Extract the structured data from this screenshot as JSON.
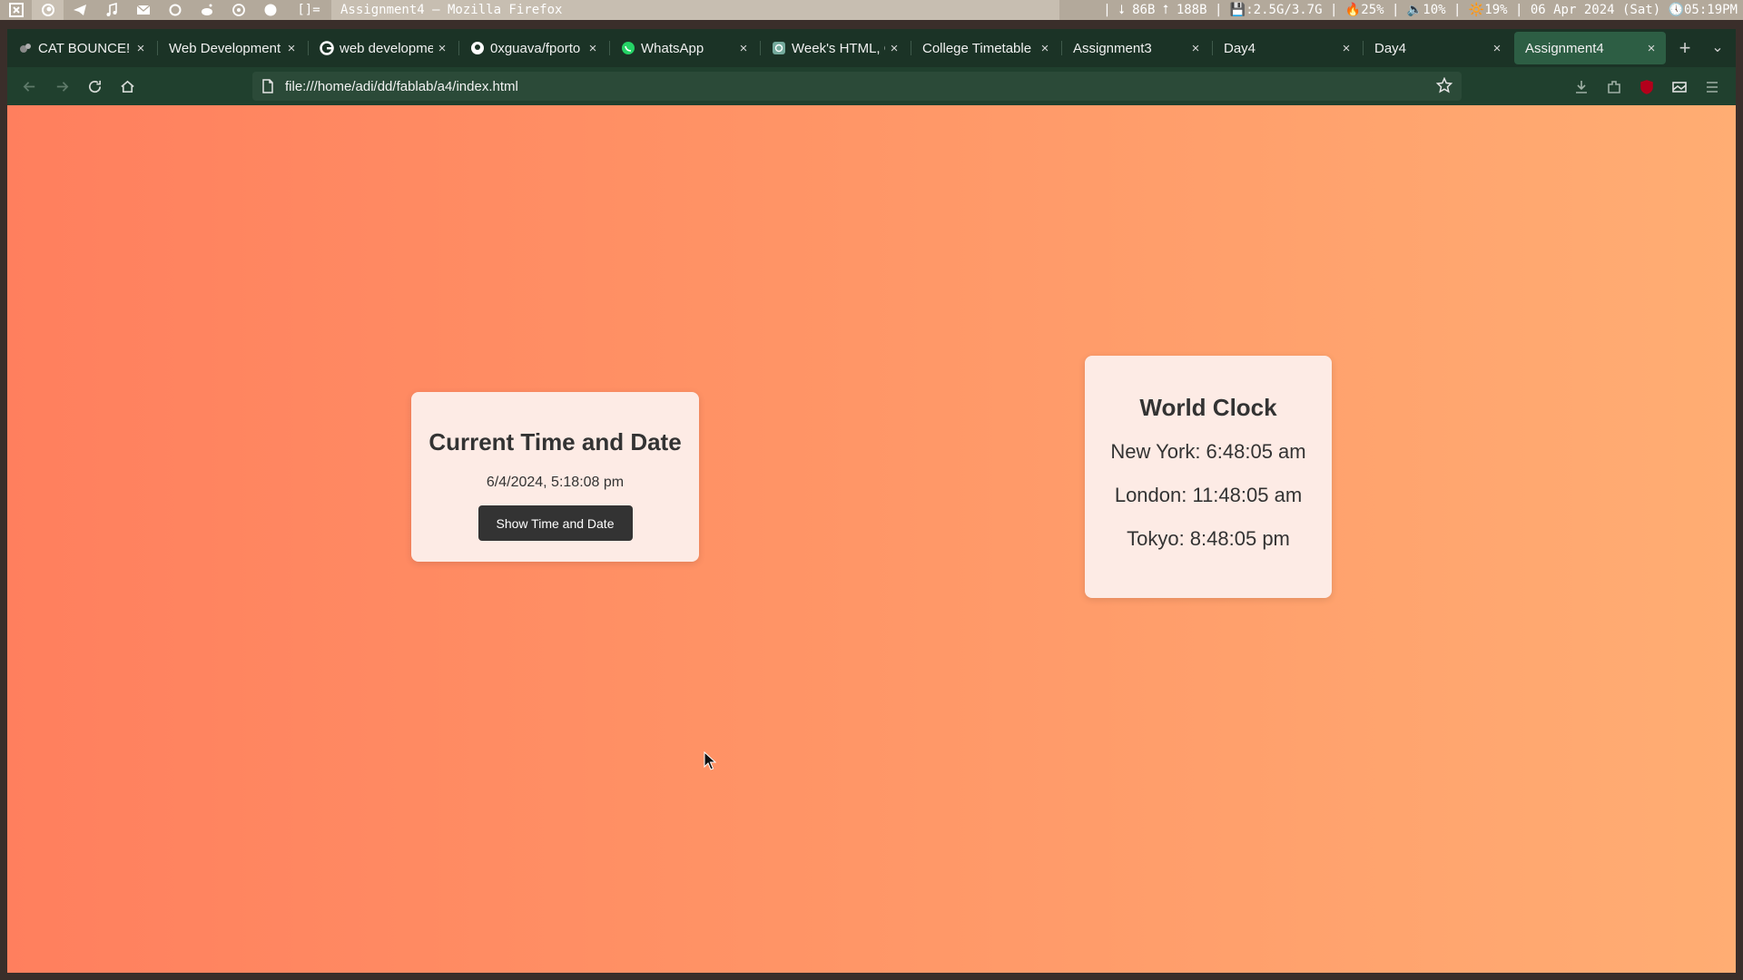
{
  "system_bar": {
    "layout_indicator": "[]=",
    "window_title": "Assignment4 — Mozilla Firefox",
    "status_text": "| ⭣ 86B ⭡ 188B | 💾:2.5G/3.7G | 🔥25% | 🔈10% | 🔆19% | 06 Apr 2024 (Sat) 🕔05:19PM"
  },
  "tabs": [
    {
      "label": "CAT BOUNCE!",
      "icon": "cat-favicon"
    },
    {
      "label": "Web Development",
      "icon": "none"
    },
    {
      "label": "web developme",
      "icon": "google-favicon"
    },
    {
      "label": "0xguava/fporto",
      "icon": "github-favicon"
    },
    {
      "label": "WhatsApp",
      "icon": "whatsapp-favicon"
    },
    {
      "label": "Week's HTML, C",
      "icon": "chatgpt-favicon"
    },
    {
      "label": "College Timetable",
      "icon": "none"
    },
    {
      "label": "Assignment3",
      "icon": "none"
    },
    {
      "label": "Day4",
      "icon": "none"
    },
    {
      "label": "Day4",
      "icon": "none"
    },
    {
      "label": "Assignment4",
      "icon": "none",
      "active": true
    }
  ],
  "tab_close_glyph": "×",
  "new_tab_glyph": "+",
  "tab_list_glyph": "⌄",
  "navbar": {
    "url": "file:///home/adi/dd/fablab/a4/index.html"
  },
  "page": {
    "clock_card": {
      "title": "Current Time and Date",
      "datetime": "6/4/2024, 5:18:08 pm",
      "button_label": "Show Time and Date"
    },
    "world_clock": {
      "title": "World Clock",
      "cities": [
        "New York: 6:48:05 am",
        "London: 11:48:05 am",
        "Tokyo: 8:48:05 pm"
      ]
    }
  },
  "colors": {
    "gradient_start": "#ff7f5e",
    "gradient_end": "#ffad73",
    "card_bg": "#fdebe5",
    "button_bg": "#333333",
    "tab_active": "#2d5e44"
  }
}
